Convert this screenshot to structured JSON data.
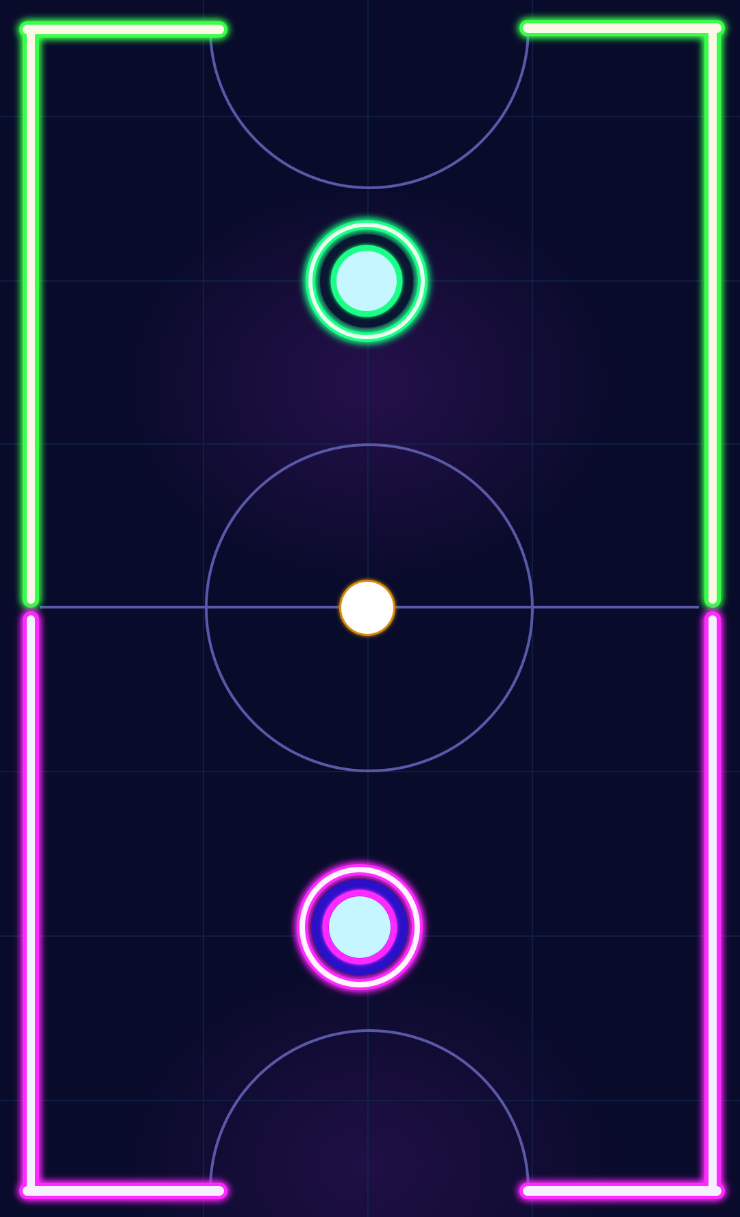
{
  "game": {
    "name": "air-hockey",
    "scene": "neon rink"
  },
  "theme": {
    "background": "#090b2b",
    "grid_color": "#12305a",
    "marking_color": "#5a58a8",
    "top_wall_color": "#39ff4a",
    "top_wall_core": "#fbf8e8",
    "bottom_wall_color": "#ff2bff",
    "bottom_wall_core": "#f4f0ff",
    "top_paddle_ring": "#1dff86",
    "top_paddle_core": "#c6f6ff",
    "bottom_paddle_ring": "#ff2bff",
    "bottom_paddle_core": "#c6f6ff",
    "bottom_paddle_inner": "#2a10c8",
    "puck_color": "#ffffff",
    "puck_rim": "#d88a10"
  },
  "icons": {
    "top_paddle": "mallet-icon",
    "bottom_paddle": "mallet-icon",
    "puck": "puck-icon"
  }
}
